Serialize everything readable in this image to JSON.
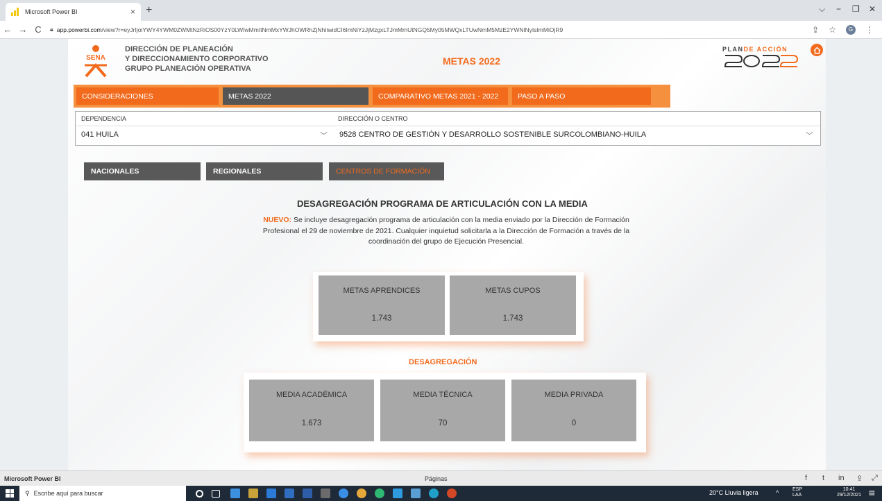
{
  "browser": {
    "tab_title": "Microsoft Power BI",
    "tab_close": "×",
    "new_tab": "+",
    "url_domain": "app.powerbi.com",
    "url_path": "/view?r=eyJrIjoiYWY4YWM0ZWMtNzRiOS00YzY0LWIwMmItNmMxYWJhOWRhZjNhIiwidCI6ImNiYzJjMzgxLTJmMmUtNGQ5My05MWQxLTUwNmM5MzE2YWNlNyIsImMiOjR9",
    "nav": {
      "back": "←",
      "forward": "→",
      "reload": "C"
    },
    "window": {
      "dropdown": "⌵",
      "minimize": "−",
      "restore": "❐",
      "close": "✕"
    },
    "profile_initial": "G"
  },
  "report": {
    "header_lines": [
      "DIRECCIÓN DE PLANEACIÓN",
      "Y DIRECCIONAMIENTO CORPORATIVO",
      "GRUPO PLANEACIÓN OPERATIVA"
    ],
    "logo_text": "SENA",
    "page_title": "METAS 2022",
    "plan_logo": {
      "prefix": "PLAN",
      "suffix": "DE ACCIÓN",
      "year": "2022"
    },
    "nav_buttons": [
      {
        "label": "CONSIDERACIONES"
      },
      {
        "label": "METAS 2022"
      },
      {
        "label": "COMPARATIVO METAS 2021 - 2022"
      },
      {
        "label": "PASO A PASO"
      }
    ],
    "filters": {
      "dependencia_label": "DEPENDENCIA",
      "dependencia_value": "041 HUILA",
      "direccion_label": "DIRECCIÓN O CENTRO",
      "direccion_value": "9528 CENTRO DE GESTIÓN Y DESARROLLO SOSTENIBLE SURCOLOMBIANO-HUILA"
    },
    "sub_tabs": [
      {
        "label": "NACIONALES"
      },
      {
        "label": "REGIONALES"
      },
      {
        "label": "CENTROS DE FORMACIÓN"
      }
    ],
    "section_title": "DESAGREGACIÓN PROGRAMA DE ARTICULACIÓN CON LA MEDIA",
    "note_prefix": "NUEVO:",
    "note_text": " Se incluye desagregación programa de articulación con la media enviado por la Dirección de Formación Profesional el 29 de noviembre de 2021. Cualquier inquietud solicitarla a la Dirección de Formación a través de la coordinación del grupo de Ejecución Presencial.",
    "cards_top": [
      {
        "label": "METAS APRENDICES",
        "value": "1.743"
      },
      {
        "label": "METAS CUPOS",
        "value": "1.743"
      }
    ],
    "desag_title": "DESAGREGACIÓN",
    "cards_bottom": [
      {
        "label": "MEDIA ACADÉMICA",
        "value": "1.673"
      },
      {
        "label": "MEDIA TÉCNICA",
        "value": "70"
      },
      {
        "label": "MEDIA PRIVADA",
        "value": "0"
      }
    ]
  },
  "footer": {
    "brand": "Microsoft Power BI",
    "pages": "Páginas"
  },
  "taskbar": {
    "search_placeholder": "Escribe aquí para buscar",
    "weather": "20°C  Lluvia ligera",
    "lang_1": "ESP",
    "lang_2": "LAA",
    "time": "10:41",
    "date": "29/12/2021"
  },
  "colors": {
    "accent_orange": "#f26b1d",
    "nav_bar": "#f5913e",
    "dark_tab": "#555555",
    "card_gray": "#a8a8a8",
    "taskbar": "#1f2a38"
  }
}
